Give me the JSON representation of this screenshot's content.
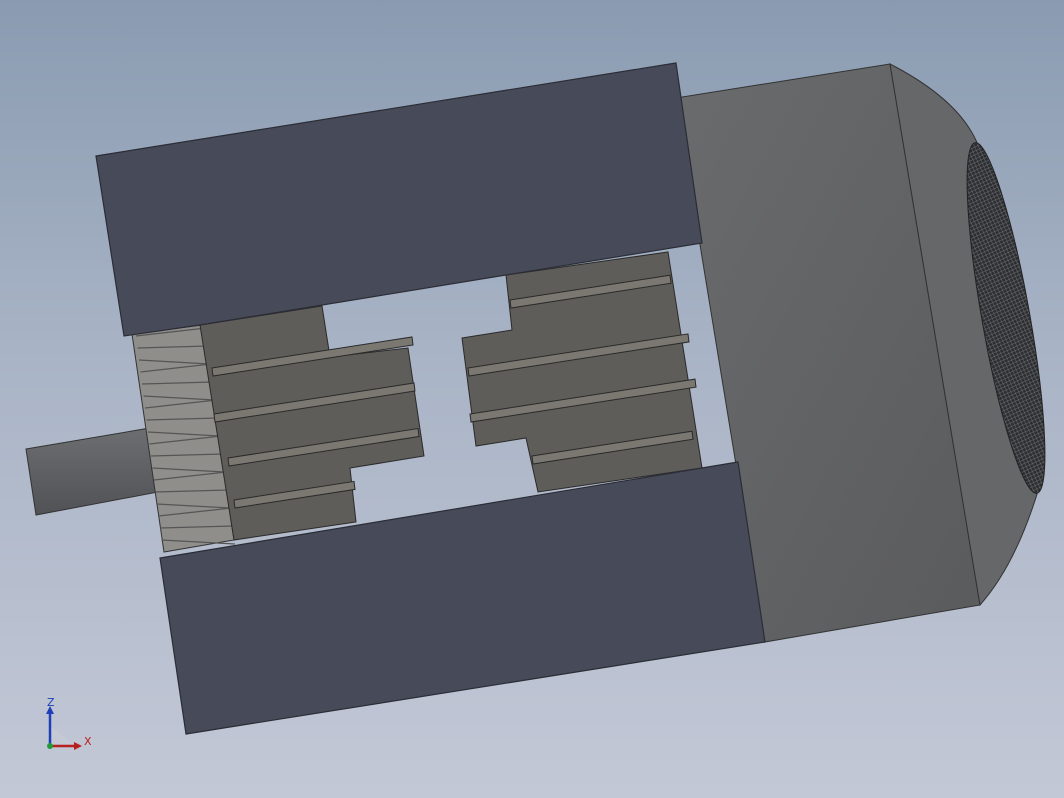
{
  "viewport": {
    "model": "motor-cutaway",
    "background_top": "#8a9bb1",
    "background_bottom": "#c3c8d6"
  },
  "triad": {
    "z_label": "Z",
    "x_label": "X",
    "z_color": "#1f3fb8",
    "x_color": "#b81f1f",
    "origin_color": "#1f9c3a"
  },
  "colors": {
    "housing": "#474a58",
    "housing_edge": "#2b2d36",
    "end_cap": "#636466",
    "end_cap_light": "#6e6f70",
    "fan_grille": "#3a3b3d",
    "stator_core": "#5f5d59",
    "stator_slot": "#7b7872",
    "fan_blades": "#8f8e8a",
    "shaft": "#606265"
  }
}
